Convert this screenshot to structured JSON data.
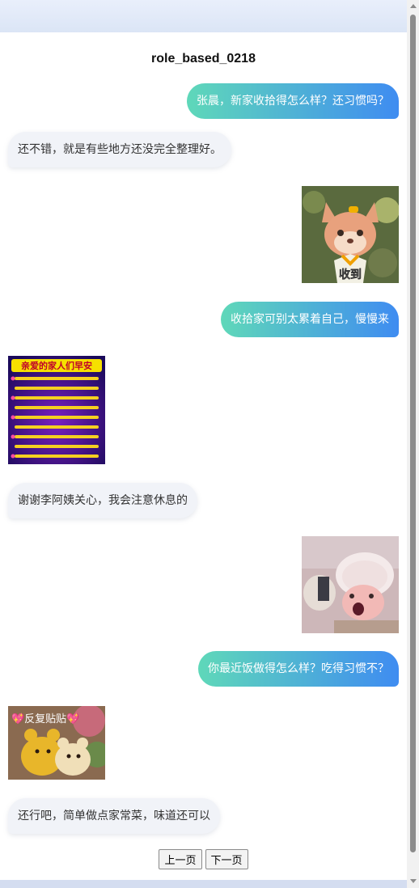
{
  "page": {
    "title": "role_based_0218"
  },
  "messages": [
    {
      "side": "right",
      "type": "text",
      "text": "张晨，新家收拾得怎么样？还习惯吗？"
    },
    {
      "side": "left",
      "type": "text",
      "text": "还不错，就是有些地方还没完全整理好。"
    },
    {
      "side": "right",
      "type": "sticker",
      "sticker": "fox-plush-sticker",
      "caption": "收到"
    },
    {
      "side": "right",
      "type": "text",
      "text": "收拾家可别太累着自己，慢慢来"
    },
    {
      "side": "left",
      "type": "sticker",
      "sticker": "good-morning-card-sticker",
      "caption": "亲爱的家人们早安"
    },
    {
      "side": "left",
      "type": "text",
      "text": "谢谢李阿姨关心，我会注意休息的"
    },
    {
      "side": "right",
      "type": "sticker",
      "sticker": "baby-doll-sticker"
    },
    {
      "side": "right",
      "type": "text",
      "text": "你最近饭做得怎么样？吃得习惯不？"
    },
    {
      "side": "left",
      "type": "sticker",
      "sticker": "teddy-bears-sticker",
      "caption": "💖反复贴贴💖"
    },
    {
      "side": "left",
      "type": "text",
      "text": "还行吧，简单做点家常菜，味道还可以"
    }
  ],
  "pager": {
    "prev_label": "上一页",
    "next_label": "下一页"
  },
  "colors": {
    "bubble_right_start": "#5fd8b9",
    "bubble_right_end": "#3f8cf1",
    "bubble_left": "#f1f3f8"
  }
}
